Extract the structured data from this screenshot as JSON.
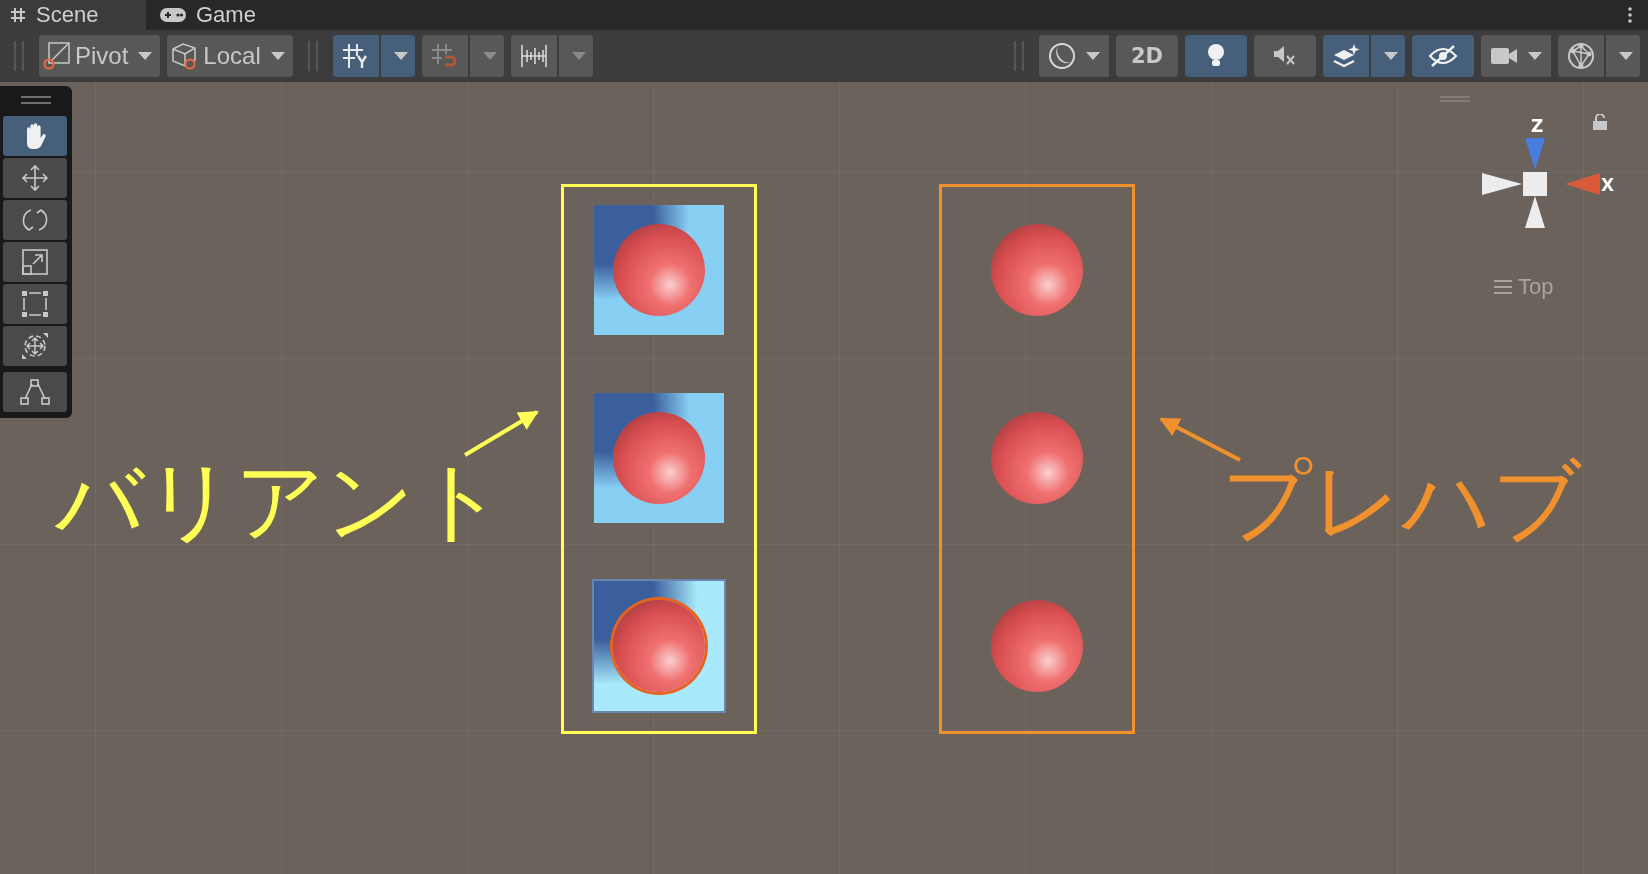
{
  "tabs": [
    {
      "kind": "scene",
      "label": "Scene",
      "selected": true
    },
    {
      "kind": "game",
      "label": "Game",
      "selected": false
    }
  ],
  "handle_position": {
    "label": "Pivot"
  },
  "handle_rotation": {
    "label": "Local"
  },
  "grid_toggles": [
    {
      "kind": "grid",
      "on": true
    },
    {
      "kind": "snap",
      "on": false
    },
    {
      "kind": "increment",
      "on": false
    }
  ],
  "view_toggles": [
    {
      "kind": "shading",
      "on": false,
      "dropdown": true
    },
    {
      "kind": "mode2d",
      "label": "2D",
      "on": false,
      "dropdown": false
    },
    {
      "kind": "lighting",
      "on": true,
      "dropdown": false
    },
    {
      "kind": "audio",
      "on": false,
      "dropdown": false
    },
    {
      "kind": "effects",
      "on": true,
      "dropdown": true
    },
    {
      "kind": "visibility",
      "on": true,
      "dropdown": false
    },
    {
      "kind": "camera",
      "on": false,
      "dropdown": true
    },
    {
      "kind": "gizmos",
      "on": false,
      "dropdown": true
    }
  ],
  "tools": [
    {
      "kind": "hand",
      "selected": true
    },
    {
      "kind": "move",
      "selected": false
    },
    {
      "kind": "rotate",
      "selected": false
    },
    {
      "kind": "scale",
      "selected": false
    },
    {
      "kind": "rect",
      "selected": false
    },
    {
      "kind": "transform",
      "selected": false
    }
  ],
  "custom_tools": [
    {
      "kind": "path",
      "selected": false
    }
  ],
  "orientation_gizmo": {
    "axes": [
      {
        "kind": "z",
        "label": "Z"
      },
      {
        "kind": "x",
        "label": "X"
      }
    ],
    "locked": false,
    "view": "Top"
  },
  "groups": [
    {
      "kind": "variant",
      "label": "バリアント",
      "color": "#ffff55",
      "objects": [
        {
          "selected": false
        },
        {
          "selected": false
        },
        {
          "selected": true
        }
      ]
    },
    {
      "kind": "prefab",
      "label": "プレハブ",
      "color": "#f0912d",
      "objects": [
        {
          "selected": false
        },
        {
          "selected": false
        },
        {
          "selected": false
        }
      ]
    }
  ]
}
